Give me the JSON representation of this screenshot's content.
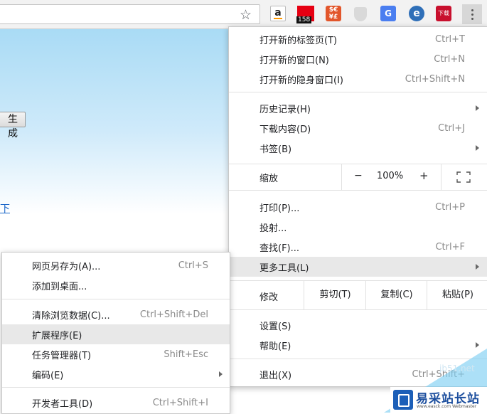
{
  "toolbar": {
    "star_icon": "star-icon",
    "extensions": [
      {
        "icon": "amazon-icon",
        "text": "a"
      },
      {
        "icon": "red-box-icon",
        "badge": "158"
      },
      {
        "icon": "currency-icon",
        "text": "$€\n¥£"
      },
      {
        "icon": "shield-icon"
      },
      {
        "icon": "translate-icon",
        "text": "G"
      },
      {
        "icon": "e-icon",
        "text": "e"
      },
      {
        "icon": "download-icon",
        "text": "下载"
      }
    ],
    "menu_icon": "three-dots-icon"
  },
  "page": {
    "button_label": "生 成",
    "link_text": "下"
  },
  "main_menu": {
    "new_tab": {
      "label": "打开新的标签页(T)",
      "shortcut": "Ctrl+T"
    },
    "new_window": {
      "label": "打开新的窗口(N)",
      "shortcut": "Ctrl+N"
    },
    "incognito": {
      "label": "打开新的隐身窗口(I)",
      "shortcut": "Ctrl+Shift+N"
    },
    "history": {
      "label": "历史记录(H)"
    },
    "downloads": {
      "label": "下载内容(D)",
      "shortcut": "Ctrl+J"
    },
    "bookmarks": {
      "label": "书签(B)"
    },
    "zoom": {
      "label": "缩放",
      "minus": "−",
      "value": "100%",
      "plus": "+"
    },
    "print": {
      "label": "打印(P)...",
      "shortcut": "Ctrl+P"
    },
    "cast": {
      "label": "投射..."
    },
    "find": {
      "label": "查找(F)...",
      "shortcut": "Ctrl+F"
    },
    "more_tools": {
      "label": "更多工具(L)"
    },
    "edit": {
      "label": "修改",
      "cut": "剪切(T)",
      "copy": "复制(C)",
      "paste": "粘贴(P)"
    },
    "settings": {
      "label": "设置(S)"
    },
    "help": {
      "label": "帮助(E)"
    },
    "exit": {
      "label": "退出(X)",
      "shortcut": "Ctrl+Shift+"
    }
  },
  "sub_menu": {
    "save_as": {
      "label": "网页另存为(A)...",
      "shortcut": "Ctrl+S"
    },
    "add_desktop": {
      "label": "添加到桌面..."
    },
    "clear_data": {
      "label": "清除浏览数据(C)...",
      "shortcut": "Ctrl+Shift+Del"
    },
    "extensions": {
      "label": "扩展程序(E)"
    },
    "task_manager": {
      "label": "任务管理器(T)",
      "shortcut": "Shift+Esc"
    },
    "encoding": {
      "label": "编码(E)"
    },
    "devtools": {
      "label": "开发者工具(D)",
      "shortcut": "Ctrl+Shift+I"
    }
  },
  "watermark": {
    "title": "易采站长站",
    "url": "www.easck.com Webmaster",
    "faint": "jb51.net"
  },
  "colors": {
    "highlight": "#e8e8e8",
    "page_gradient_top": "#a9dbf5",
    "watermark_blue": "#1d4f9e"
  }
}
